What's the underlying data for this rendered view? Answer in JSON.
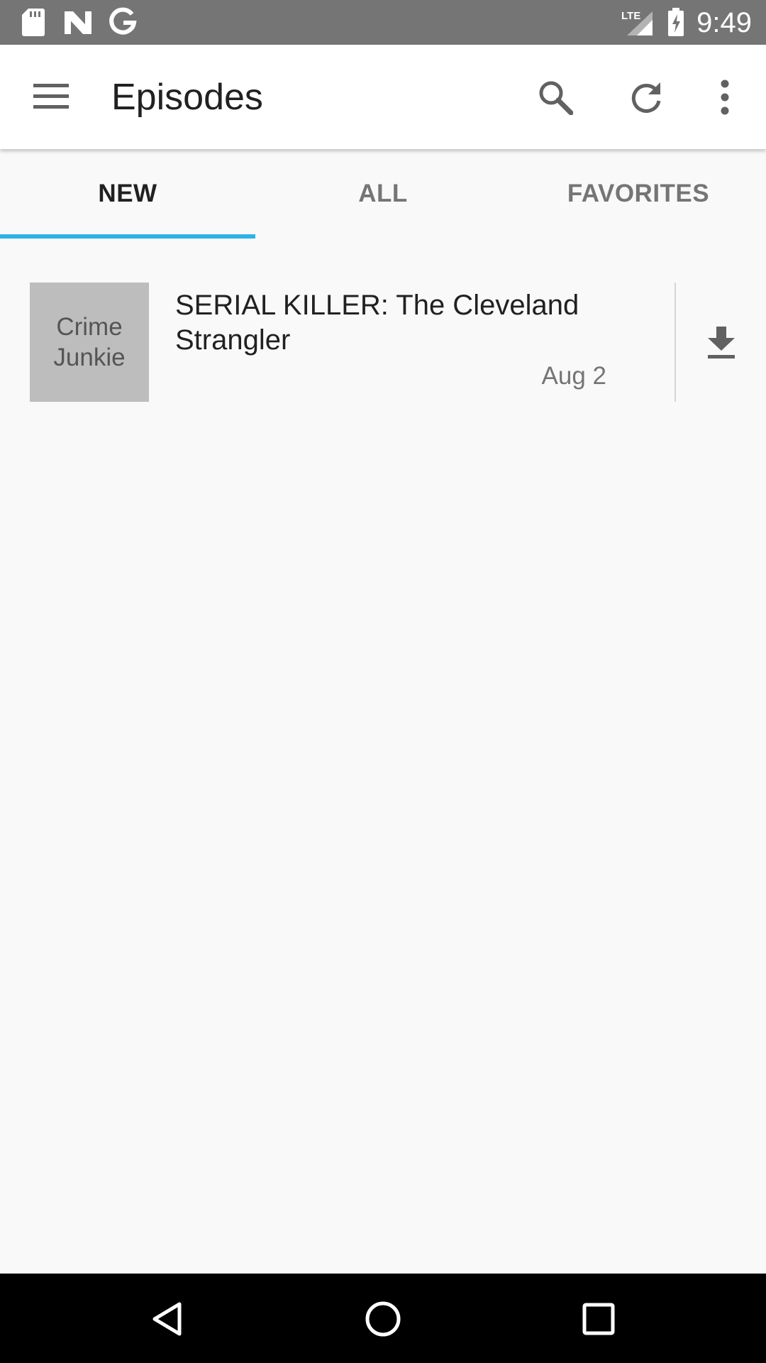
{
  "status_bar": {
    "time": "9:49",
    "left_icons": [
      "sd-card-icon",
      "n-logo-icon",
      "google-g-icon"
    ],
    "right_icons": [
      "lte-signal-icon",
      "battery-charging-icon"
    ],
    "network_label": "LTE"
  },
  "app_bar": {
    "title": "Episodes",
    "icons": [
      "menu-icon",
      "search-icon",
      "refresh-icon",
      "more-vert-icon"
    ]
  },
  "tabs": [
    {
      "label": "NEW",
      "active": true
    },
    {
      "label": "ALL",
      "active": false
    },
    {
      "label": "FAVORITES",
      "active": false
    }
  ],
  "episodes": [
    {
      "cover_text": "Crime Junkie",
      "cover_line1": "Crime",
      "cover_line2": "Junkie",
      "title": "SERIAL KILLER: The Cleveland Strangler",
      "date": "Aug 2",
      "action_icon": "download-icon"
    }
  ],
  "navigation_bar": {
    "icons": [
      "back-icon",
      "home-icon",
      "recents-icon"
    ]
  },
  "colors": {
    "status_bar": "#757575",
    "app_bar": "#ffffff",
    "tab_indicator": "#2fb3e6",
    "background": "#f9f9f9",
    "cover_placeholder": "#bdbdbd",
    "navigation_bar": "#000000"
  }
}
